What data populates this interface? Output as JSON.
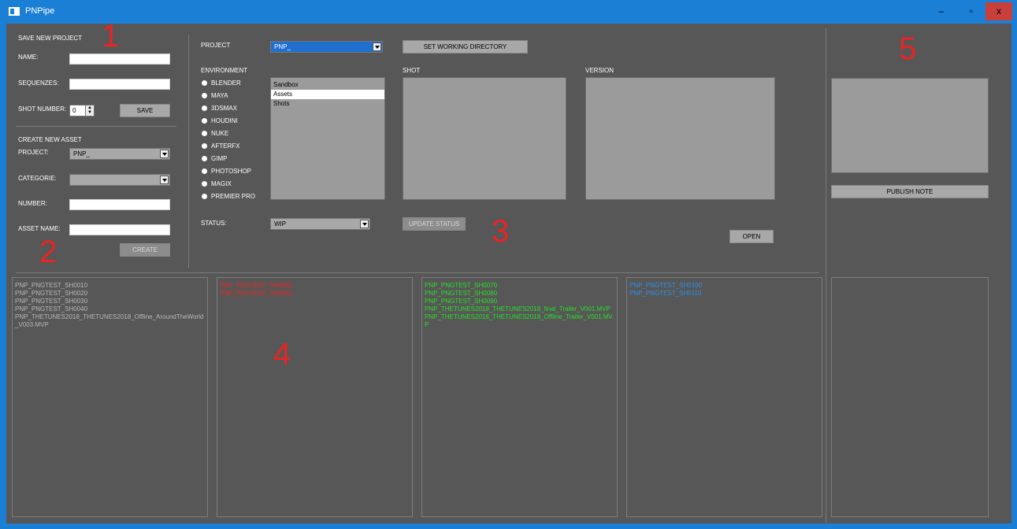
{
  "window": {
    "title": "PNPipe",
    "min_label": "–",
    "max_label": "▫",
    "close_label": "x"
  },
  "colors": {
    "titlebar": "#1c7fd6",
    "background": "#575757",
    "gray_text": "#b8b8b8",
    "red_text": "#e82424",
    "green_text": "#26e026",
    "blue_text": "#2e8fe8"
  },
  "save_project": {
    "heading": "SAVE NEW PROJECT",
    "name_label": "NAME:",
    "name_value": "",
    "sequenzes_label": "SEQUENZES:",
    "sequenzes_value": "",
    "shot_number_label": "SHOT NUMBER:",
    "shot_number_value": "0",
    "save_label": "SAVE"
  },
  "create_asset": {
    "heading": "CREATE NEW ASSET",
    "project_label": "PROJECT:",
    "project_value": "PNP_",
    "categorie_label": "CATEGORIE:",
    "categorie_value": "",
    "number_label": "NUMBER:",
    "number_value": "",
    "asset_name_label": "ASSET NAME:",
    "asset_name_value": "",
    "create_label": "CREATE"
  },
  "main": {
    "project_label": "PROJECT",
    "project_value": "PNP_",
    "set_dir_label": "SET WORKING DIRECTORY",
    "environment_label": "ENVIRONMENT",
    "environments": [
      "BLENDER",
      "MAYA",
      "3DSMAX",
      "HOUDINI",
      "NUKE",
      "AFTERFX",
      "GIMP",
      "PHOTOSHOP",
      "MAGIX",
      "PREMIER PRO"
    ],
    "categories": [
      "Sandbox",
      "Assets",
      "Shots"
    ],
    "selected_category": "Assets",
    "shot_label": "SHOT",
    "version_label": "VERSION",
    "status_label": "STATUS:",
    "status_value": "WIP",
    "update_status_label": "UPDATE STATUS",
    "open_label": "OPEN"
  },
  "publish": {
    "publish_note_label": "PUBLISH NOTE"
  },
  "status_lists": {
    "gray": [
      "PNP_PNGTEST_SH0010",
      "PNP_PNGTEST_SH0020",
      "PNP_PNGTEST_SH0030",
      "PNP_PNGTEST_SH0040",
      "PNP_THETUNES2018_THETUNES2018_Offline_AroundTheWorld_V003.MVP"
    ],
    "red": [
      "PNP_PNGTEST_SH0050",
      "PNP_PNGTEST_SH0060"
    ],
    "green": [
      "PNP_PNGTEST_SH0070",
      "PNP_PNGTEST_SH0080",
      "PNP_PNGTEST_SH0090",
      "PNP_THETUNES2018_THETUNES2018_final_Trailer_V001.MVP",
      "PNP_THETUNES2018_THETUNES2018_Offline_Trailer_V001.MVP"
    ],
    "blue": [
      "PNP_PNGTEST_SH0100",
      "PNP_PNGTEST_SH0110"
    ]
  },
  "annotations": {
    "n1": "1",
    "n2": "2",
    "n3": "3",
    "n4": "4",
    "n5": "5"
  }
}
